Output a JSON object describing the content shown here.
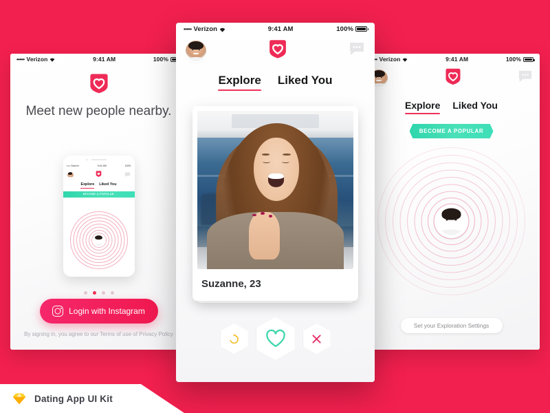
{
  "canvas": {
    "background_color": "#F2204E"
  },
  "status_bar": {
    "carrier_dots": "•••••",
    "carrier": "Verizon",
    "wifi_icon": "wifi-icon",
    "time": "9:41 AM",
    "battery_percent": "100%",
    "battery_icon": "battery-full-icon"
  },
  "nav": {
    "avatar_icon": "user-avatar",
    "logo_icon": "heart-shield-logo",
    "chat_icon": "chat-bubble-icon"
  },
  "tabs": {
    "explore": "Explore",
    "liked_you": "Liked You"
  },
  "left_screen": {
    "headline": "Meet new people nearby.",
    "mockup": {
      "status_carrier": "••••• Search",
      "status_time": "9:41 AM",
      "status_battery": "100%",
      "tab_explore": "Explore",
      "tab_liked": "Liked You",
      "badge": "BECOME A POPULAR"
    },
    "pager": {
      "count": 4,
      "active_index": 1
    },
    "login_button": {
      "label": "Login with Instagram",
      "icon": "instagram-icon",
      "color": "#F0194F"
    },
    "legal_text": "By signing in, you agree to our Terms of use of Privacy Policy"
  },
  "center_screen": {
    "card": {
      "name_age": "Suzanne, 23",
      "photo_alt": "laughing-woman-photo"
    },
    "actions": [
      {
        "name": "rewind-button",
        "icon": "undo-arrow-icon",
        "color": "#F5BE2C"
      },
      {
        "name": "like-button",
        "icon": "heart-icon",
        "color": "#3FD7AC"
      },
      {
        "name": "dislike-button",
        "icon": "close-x-icon",
        "color": "#E8346B"
      }
    ]
  },
  "right_screen": {
    "badge": "BECOME A POPULAR",
    "badge_color": "#3DDFB8",
    "radar": {
      "rings": 10,
      "ring_color": "#E23D6A",
      "center_icon": "user-avatar"
    },
    "settings_button": "Set your Exploration Settings"
  },
  "footer": {
    "logo_icon": "sketch-diamond-icon",
    "title": "Dating App  UI Kit"
  }
}
